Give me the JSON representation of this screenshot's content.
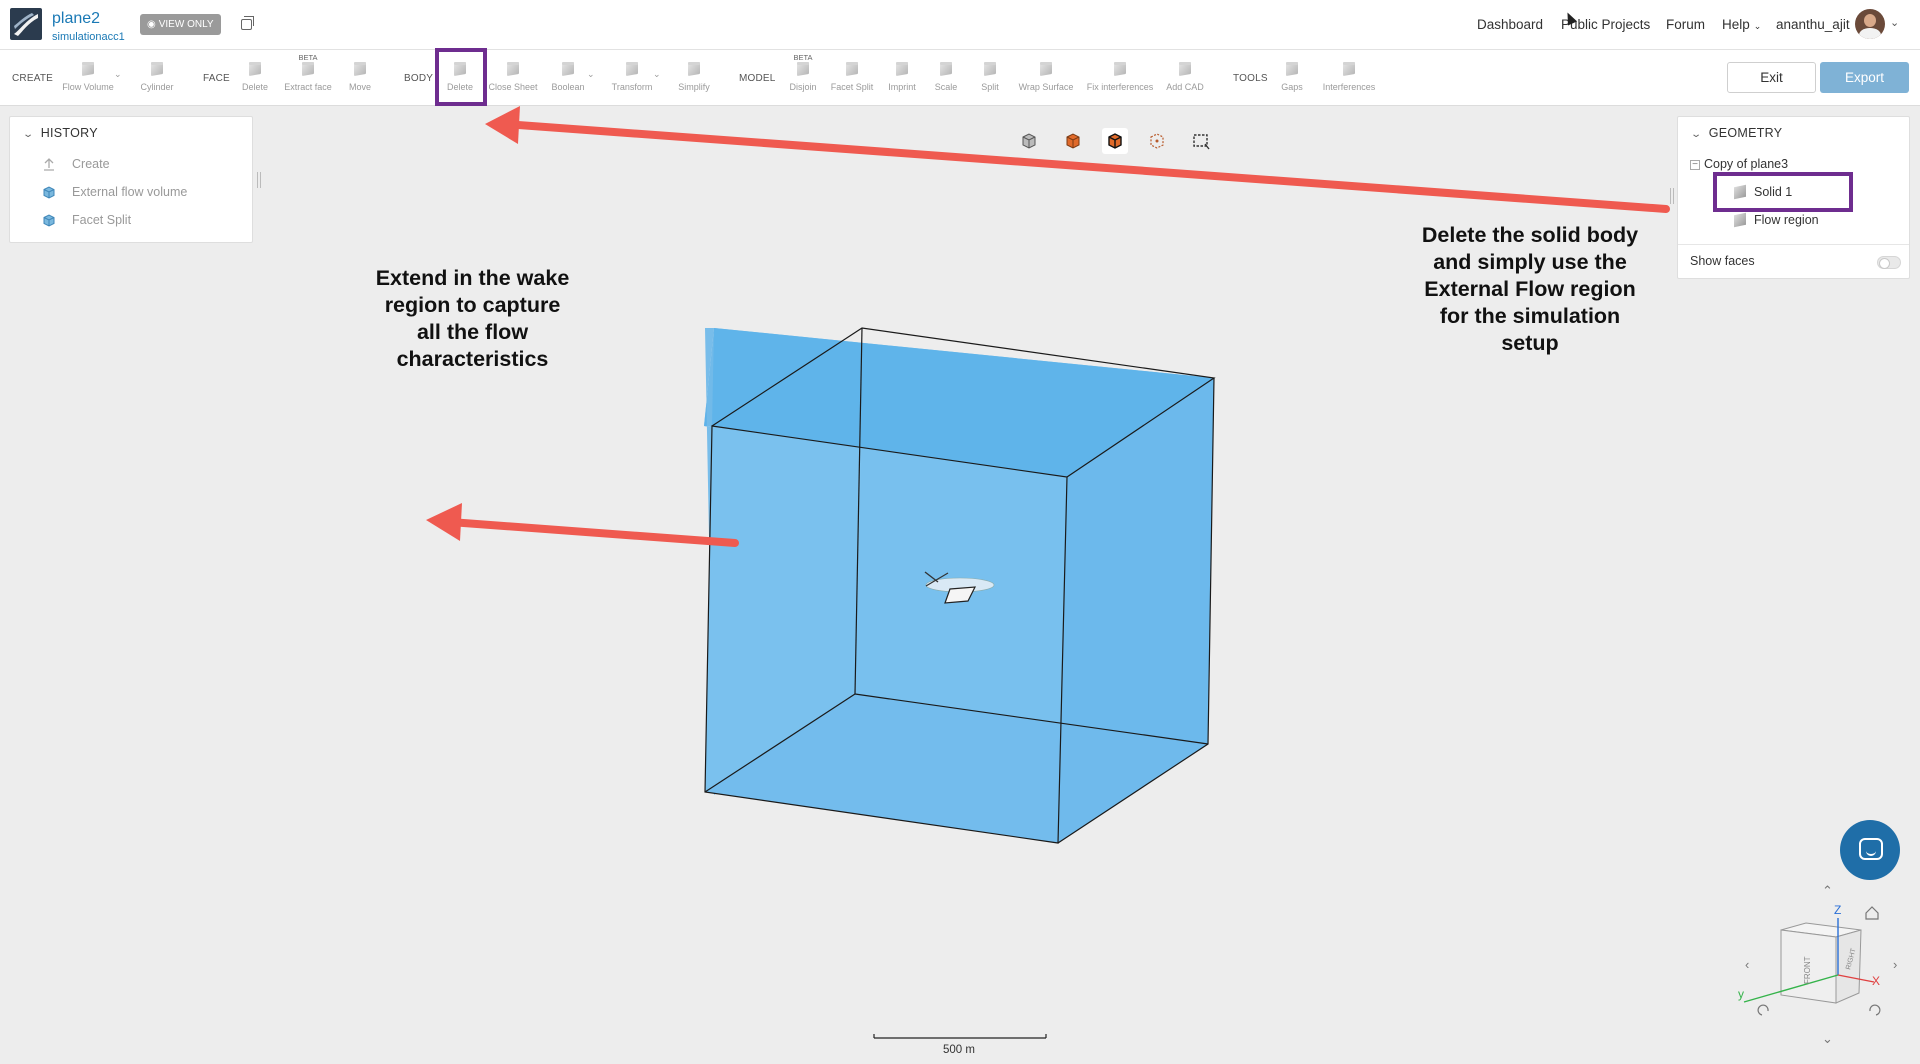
{
  "project": {
    "name": "plane2",
    "owner": "simulationacc1",
    "view_only_label": "VIEW ONLY"
  },
  "nav": {
    "dashboard": "Dashboard",
    "public_projects": "Public Projects",
    "forum": "Forum",
    "help": "Help",
    "user": "ananthu_ajit"
  },
  "toolbar": {
    "groups": {
      "create": "CREATE",
      "face": "FACE",
      "body": "BODY",
      "model": "MODEL",
      "tools": "TOOLS"
    },
    "items": {
      "flow_volume": "Flow Volume",
      "cylinder": "Cylinder",
      "face_delete": "Delete",
      "extract_face": "Extract face",
      "move": "Move",
      "body_delete": "Delete",
      "close_sheet": "Close Sheet",
      "boolean": "Boolean",
      "transform": "Transform",
      "simplify": "Simplify",
      "disjoin": "Disjoin",
      "facet_split": "Facet Split",
      "imprint": "Imprint",
      "scale": "Scale",
      "split": "Split",
      "wrap_surface": "Wrap Surface",
      "fix_interferences": "Fix interferences",
      "add_cad": "Add CAD",
      "gaps": "Gaps",
      "interferences": "Interferences"
    },
    "beta_label": "BETA",
    "exit": "Exit",
    "export": "Export"
  },
  "history": {
    "title": "HISTORY",
    "items": [
      "Create",
      "External flow volume",
      "Facet Split"
    ]
  },
  "geometry": {
    "title": "GEOMETRY",
    "root": "Copy of plane3",
    "children": [
      "Solid 1",
      "Flow region"
    ],
    "show_faces": "Show faces",
    "show_faces_on": false
  },
  "annotations": {
    "left": "Extend in the wake region to capture all the flow characteristics",
    "right": "Delete the solid body and simply use the External Flow region for the simulation setup"
  },
  "view_cube": {
    "z_label": "Z",
    "y_label": "y",
    "x_label": "X",
    "front_label": "FRONT",
    "right_label": "RIGHT"
  },
  "scale_bar": {
    "label": "500 m"
  },
  "colors": {
    "accent": "#1a79b5",
    "highlight": "#6e2d8f",
    "arrow": "#ef5a50",
    "volume_fill": "#5ab0e8"
  }
}
